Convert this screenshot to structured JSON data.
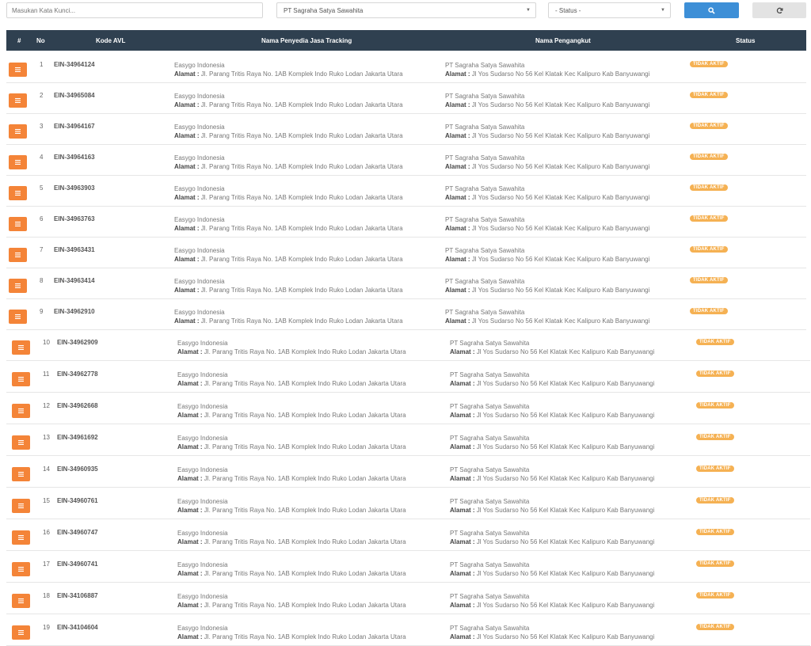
{
  "filters": {
    "search_placeholder": "Masukan Kata Kunci...",
    "company_selected": "PT Sagraha Satya Sawahita",
    "status_selected": "- Status -",
    "search_icon": "search-icon",
    "reset_icon": "refresh-icon"
  },
  "table": {
    "headers": {
      "hash": "#",
      "no": "No",
      "kode": "Kode AVL",
      "penyedia": "Nama Penyedia Jasa Tracking",
      "pengangkut": "Nama Pengangkut",
      "status": "Status"
    },
    "rows": [
      {
        "no": "1",
        "kode": "EIN-34964124",
        "penyedia": "Easygo Indonesia",
        "penyedia_alamat": "Jl. Parang Tritis Raya No. 1AB Komplek Indo Ruko Lodan Jakarta Utara",
        "pengangkut": "PT Sagraha Satya Sawahita",
        "pengangkut_alamat": "Jl Yos Sudarso No 56 Kel Klatak Kec Kalipuro Kab Banyuwangi",
        "status": "TIDAK AKTIF"
      },
      {
        "no": "2",
        "kode": "EIN-34965084",
        "penyedia": "Easygo Indonesia",
        "penyedia_alamat": "Jl. Parang Tritis Raya No. 1AB Komplek Indo Ruko Lodan Jakarta Utara",
        "pengangkut": "PT Sagraha Satya Sawahita",
        "pengangkut_alamat": "Jl Yos Sudarso No 56 Kel Klatak Kec Kalipuro Kab Banyuwangi",
        "status": "TIDAK AKTIF"
      },
      {
        "no": "3",
        "kode": "EIN-34964167",
        "penyedia": "Easygo Indonesia",
        "penyedia_alamat": "Jl. Parang Tritis Raya No. 1AB Komplek Indo Ruko Lodan Jakarta Utara",
        "pengangkut": "PT Sagraha Satya Sawahita",
        "pengangkut_alamat": "Jl Yos Sudarso No 56 Kel Klatak Kec Kalipuro Kab Banyuwangi",
        "status": "TIDAK AKTIF"
      },
      {
        "no": "4",
        "kode": "EIN-34964163",
        "penyedia": "Easygo Indonesia",
        "penyedia_alamat": "Jl. Parang Tritis Raya No. 1AB Komplek Indo Ruko Lodan Jakarta Utara",
        "pengangkut": "PT Sagraha Satya Sawahita",
        "pengangkut_alamat": "Jl Yos Sudarso No 56 Kel Klatak Kec Kalipuro Kab Banyuwangi",
        "status": "TIDAK AKTIF"
      },
      {
        "no": "5",
        "kode": "EIN-34963903",
        "penyedia": "Easygo Indonesia",
        "penyedia_alamat": "Jl. Parang Tritis Raya No. 1AB Komplek Indo Ruko Lodan Jakarta Utara",
        "pengangkut": "PT Sagraha Satya Sawahita",
        "pengangkut_alamat": "Jl Yos Sudarso No 56 Kel Klatak Kec Kalipuro Kab Banyuwangi",
        "status": "TIDAK AKTIF"
      },
      {
        "no": "6",
        "kode": "EIN-34963763",
        "penyedia": "Easygo Indonesia",
        "penyedia_alamat": "Jl. Parang Tritis Raya No. 1AB Komplek Indo Ruko Lodan Jakarta Utara",
        "pengangkut": "PT Sagraha Satya Sawahita",
        "pengangkut_alamat": "Jl Yos Sudarso No 56 Kel Klatak Kec Kalipuro Kab Banyuwangi",
        "status": "TIDAK AKTIF"
      },
      {
        "no": "7",
        "kode": "EIN-34963431",
        "penyedia": "Easygo Indonesia",
        "penyedia_alamat": "Jl. Parang Tritis Raya No. 1AB Komplek Indo Ruko Lodan Jakarta Utara",
        "pengangkut": "PT Sagraha Satya Sawahita",
        "pengangkut_alamat": "Jl Yos Sudarso No 56 Kel Klatak Kec Kalipuro Kab Banyuwangi",
        "status": "TIDAK AKTIF"
      },
      {
        "no": "8",
        "kode": "EIN-34963414",
        "penyedia": "Easygo Indonesia",
        "penyedia_alamat": "Jl. Parang Tritis Raya No. 1AB Komplek Indo Ruko Lodan Jakarta Utara",
        "pengangkut": "PT Sagraha Satya Sawahita",
        "pengangkut_alamat": "Jl Yos Sudarso No 56 Kel Klatak Kec Kalipuro Kab Banyuwangi",
        "status": "TIDAK AKTIF"
      },
      {
        "no": "9",
        "kode": "EIN-34962910",
        "penyedia": "Easygo Indonesia",
        "penyedia_alamat": "Jl. Parang Tritis Raya No. 1AB Komplek Indo Ruko Lodan Jakarta Utara",
        "pengangkut": "PT Sagraha Satya Sawahita",
        "pengangkut_alamat": "Jl Yos Sudarso No 56 Kel Klatak Kec Kalipuro Kab Banyuwangi",
        "status": "TIDAK AKTIF"
      },
      {
        "no": "10",
        "kode": "EIN-34962909",
        "penyedia": "Easygo Indonesia",
        "penyedia_alamat": "Jl. Parang Tritis Raya No. 1AB Komplek Indo Ruko Lodan Jakarta Utara",
        "pengangkut": "PT Sagraha Satya Sawahita",
        "pengangkut_alamat": "Jl Yos Sudarso No 56 Kel Klatak Kec Kalipuro Kab Banyuwangi",
        "status": "TIDAK AKTIF"
      },
      {
        "no": "11",
        "kode": "EIN-34962778",
        "penyedia": "Easygo Indonesia",
        "penyedia_alamat": "Jl. Parang Tritis Raya No. 1AB Komplek Indo Ruko Lodan Jakarta Utara",
        "pengangkut": "PT Sagraha Satya Sawahita",
        "pengangkut_alamat": "Jl Yos Sudarso No 56 Kel Klatak Kec Kalipuro Kab Banyuwangi",
        "status": "TIDAK AKTIF"
      },
      {
        "no": "12",
        "kode": "EIN-34962668",
        "penyedia": "Easygo Indonesia",
        "penyedia_alamat": "Jl. Parang Tritis Raya No. 1AB Komplek Indo Ruko Lodan Jakarta Utara",
        "pengangkut": "PT Sagraha Satya Sawahita",
        "pengangkut_alamat": "Jl Yos Sudarso No 56 Kel Klatak Kec Kalipuro Kab Banyuwangi",
        "status": "TIDAK AKTIF"
      },
      {
        "no": "13",
        "kode": "EIN-34961692",
        "penyedia": "Easygo Indonesia",
        "penyedia_alamat": "Jl. Parang Tritis Raya No. 1AB Komplek Indo Ruko Lodan Jakarta Utara",
        "pengangkut": "PT Sagraha Satya Sawahita",
        "pengangkut_alamat": "Jl Yos Sudarso No 56 Kel Klatak Kec Kalipuro Kab Banyuwangi",
        "status": "TIDAK AKTIF"
      },
      {
        "no": "14",
        "kode": "EIN-34960935",
        "penyedia": "Easygo Indonesia",
        "penyedia_alamat": "Jl. Parang Tritis Raya No. 1AB Komplek Indo Ruko Lodan Jakarta Utara",
        "pengangkut": "PT Sagraha Satya Sawahita",
        "pengangkut_alamat": "Jl Yos Sudarso No 56 Kel Klatak Kec Kalipuro Kab Banyuwangi",
        "status": "TIDAK AKTIF"
      },
      {
        "no": "15",
        "kode": "EIN-34960761",
        "penyedia": "Easygo Indonesia",
        "penyedia_alamat": "Jl. Parang Tritis Raya No. 1AB Komplek Indo Ruko Lodan Jakarta Utara",
        "pengangkut": "PT Sagraha Satya Sawahita",
        "pengangkut_alamat": "Jl Yos Sudarso No 56 Kel Klatak Kec Kalipuro Kab Banyuwangi",
        "status": "TIDAK AKTIF"
      },
      {
        "no": "16",
        "kode": "EIN-34960747",
        "penyedia": "Easygo Indonesia",
        "penyedia_alamat": "Jl. Parang Tritis Raya No. 1AB Komplek Indo Ruko Lodan Jakarta Utara",
        "pengangkut": "PT Sagraha Satya Sawahita",
        "pengangkut_alamat": "Jl Yos Sudarso No 56 Kel Klatak Kec Kalipuro Kab Banyuwangi",
        "status": "TIDAK AKTIF"
      },
      {
        "no": "17",
        "kode": "EIN-34960741",
        "penyedia": "Easygo Indonesia",
        "penyedia_alamat": "Jl. Parang Tritis Raya No. 1AB Komplek Indo Ruko Lodan Jakarta Utara",
        "pengangkut": "PT Sagraha Satya Sawahita",
        "pengangkut_alamat": "Jl Yos Sudarso No 56 Kel Klatak Kec Kalipuro Kab Banyuwangi",
        "status": "TIDAK AKTIF"
      },
      {
        "no": "18",
        "kode": "EIN-34106887",
        "penyedia": "Easygo Indonesia",
        "penyedia_alamat": "Jl. Parang Tritis Raya No. 1AB Komplek Indo Ruko Lodan Jakarta Utara",
        "pengangkut": "PT Sagraha Satya Sawahita",
        "pengangkut_alamat": "Jl Yos Sudarso No 56 Kel Klatak Kec Kalipuro Kab Banyuwangi",
        "status": "TIDAK AKTIF"
      },
      {
        "no": "19",
        "kode": "EIN-34104604",
        "penyedia": "Easygo Indonesia",
        "penyedia_alamat": "Jl. Parang Tritis Raya No. 1AB Komplek Indo Ruko Lodan Jakarta Utara",
        "pengangkut": "PT Sagraha Satya Sawahita",
        "pengangkut_alamat": "Jl Yos Sudarso No 56 Kel Klatak Kec Kalipuro Kab Banyuwangi",
        "status": "TIDAK AKTIF"
      }
    ],
    "alamat_label": "Alamat :"
  },
  "colors": {
    "header_bg": "#2f4050",
    "menu_btn": "#f48438",
    "badge": "#f5b153",
    "search_btn": "#3d8fd7"
  }
}
